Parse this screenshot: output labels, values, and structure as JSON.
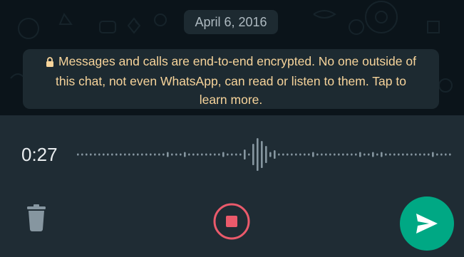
{
  "chat": {
    "date_chip": "April 6, 2016",
    "encryption_notice": "Messages and calls are end-to-end encrypted. No one outside of this chat, not even WhatsApp, can read or listen to them. Tap to learn more.",
    "notice_icon": "lock-icon"
  },
  "recorder": {
    "elapsed": "0:27",
    "delete_icon": "trash-icon",
    "stop_icon": "stop-record-icon",
    "send_icon": "send-icon"
  },
  "colors": {
    "chat_background": "#0b141a",
    "recorder_background": "#1f2c34",
    "notice_text": "#f7d49b",
    "stop_accent": "#ea5a6b",
    "send_accent": "#00a884",
    "waveform": "#8696a0"
  }
}
